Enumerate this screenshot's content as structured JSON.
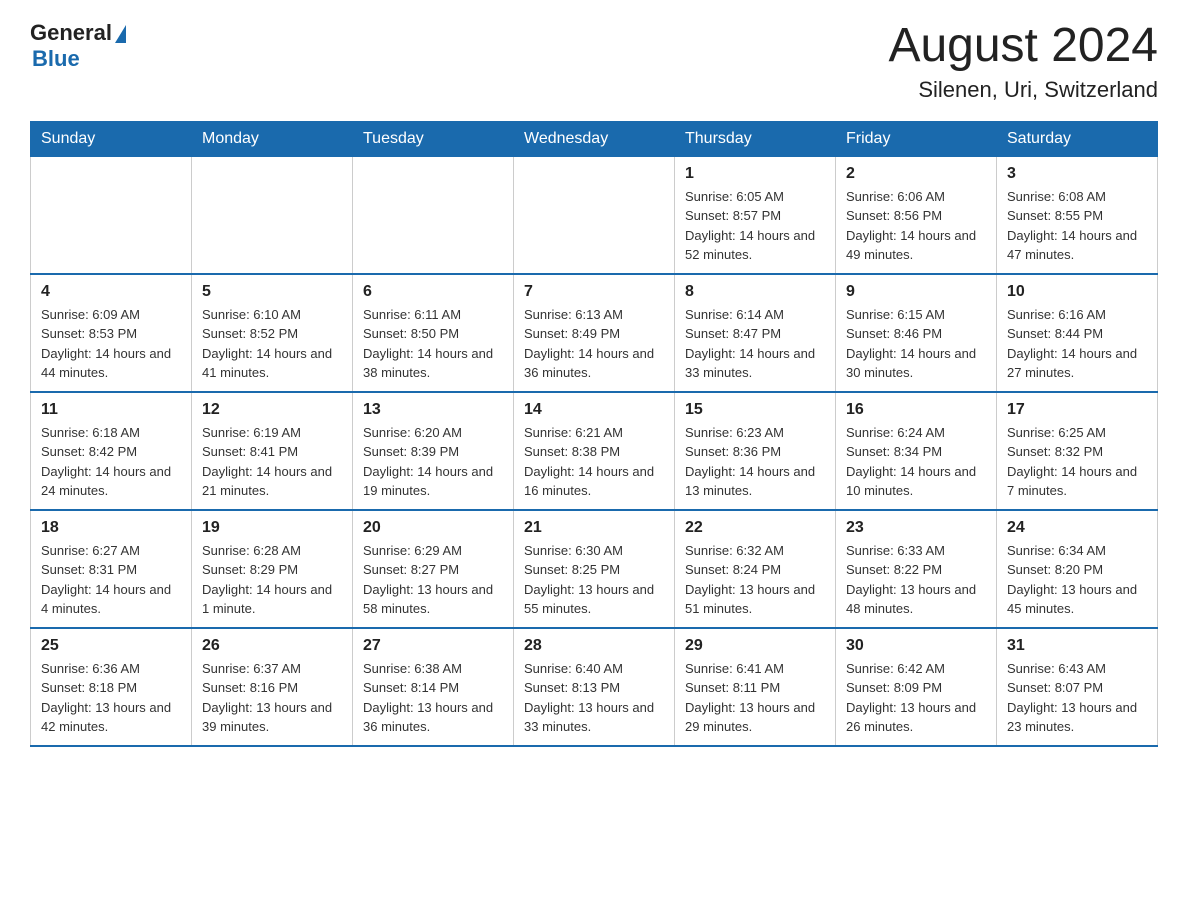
{
  "header": {
    "logo_general": "General",
    "logo_blue": "Blue",
    "month_title": "August 2024",
    "location": "Silenen, Uri, Switzerland"
  },
  "days_of_week": [
    "Sunday",
    "Monday",
    "Tuesday",
    "Wednesday",
    "Thursday",
    "Friday",
    "Saturday"
  ],
  "weeks": [
    [
      {
        "day": "",
        "info": ""
      },
      {
        "day": "",
        "info": ""
      },
      {
        "day": "",
        "info": ""
      },
      {
        "day": "",
        "info": ""
      },
      {
        "day": "1",
        "info": "Sunrise: 6:05 AM\nSunset: 8:57 PM\nDaylight: 14 hours and 52 minutes."
      },
      {
        "day": "2",
        "info": "Sunrise: 6:06 AM\nSunset: 8:56 PM\nDaylight: 14 hours and 49 minutes."
      },
      {
        "day": "3",
        "info": "Sunrise: 6:08 AM\nSunset: 8:55 PM\nDaylight: 14 hours and 47 minutes."
      }
    ],
    [
      {
        "day": "4",
        "info": "Sunrise: 6:09 AM\nSunset: 8:53 PM\nDaylight: 14 hours and 44 minutes."
      },
      {
        "day": "5",
        "info": "Sunrise: 6:10 AM\nSunset: 8:52 PM\nDaylight: 14 hours and 41 minutes."
      },
      {
        "day": "6",
        "info": "Sunrise: 6:11 AM\nSunset: 8:50 PM\nDaylight: 14 hours and 38 minutes."
      },
      {
        "day": "7",
        "info": "Sunrise: 6:13 AM\nSunset: 8:49 PM\nDaylight: 14 hours and 36 minutes."
      },
      {
        "day": "8",
        "info": "Sunrise: 6:14 AM\nSunset: 8:47 PM\nDaylight: 14 hours and 33 minutes."
      },
      {
        "day": "9",
        "info": "Sunrise: 6:15 AM\nSunset: 8:46 PM\nDaylight: 14 hours and 30 minutes."
      },
      {
        "day": "10",
        "info": "Sunrise: 6:16 AM\nSunset: 8:44 PM\nDaylight: 14 hours and 27 minutes."
      }
    ],
    [
      {
        "day": "11",
        "info": "Sunrise: 6:18 AM\nSunset: 8:42 PM\nDaylight: 14 hours and 24 minutes."
      },
      {
        "day": "12",
        "info": "Sunrise: 6:19 AM\nSunset: 8:41 PM\nDaylight: 14 hours and 21 minutes."
      },
      {
        "day": "13",
        "info": "Sunrise: 6:20 AM\nSunset: 8:39 PM\nDaylight: 14 hours and 19 minutes."
      },
      {
        "day": "14",
        "info": "Sunrise: 6:21 AM\nSunset: 8:38 PM\nDaylight: 14 hours and 16 minutes."
      },
      {
        "day": "15",
        "info": "Sunrise: 6:23 AM\nSunset: 8:36 PM\nDaylight: 14 hours and 13 minutes."
      },
      {
        "day": "16",
        "info": "Sunrise: 6:24 AM\nSunset: 8:34 PM\nDaylight: 14 hours and 10 minutes."
      },
      {
        "day": "17",
        "info": "Sunrise: 6:25 AM\nSunset: 8:32 PM\nDaylight: 14 hours and 7 minutes."
      }
    ],
    [
      {
        "day": "18",
        "info": "Sunrise: 6:27 AM\nSunset: 8:31 PM\nDaylight: 14 hours and 4 minutes."
      },
      {
        "day": "19",
        "info": "Sunrise: 6:28 AM\nSunset: 8:29 PM\nDaylight: 14 hours and 1 minute."
      },
      {
        "day": "20",
        "info": "Sunrise: 6:29 AM\nSunset: 8:27 PM\nDaylight: 13 hours and 58 minutes."
      },
      {
        "day": "21",
        "info": "Sunrise: 6:30 AM\nSunset: 8:25 PM\nDaylight: 13 hours and 55 minutes."
      },
      {
        "day": "22",
        "info": "Sunrise: 6:32 AM\nSunset: 8:24 PM\nDaylight: 13 hours and 51 minutes."
      },
      {
        "day": "23",
        "info": "Sunrise: 6:33 AM\nSunset: 8:22 PM\nDaylight: 13 hours and 48 minutes."
      },
      {
        "day": "24",
        "info": "Sunrise: 6:34 AM\nSunset: 8:20 PM\nDaylight: 13 hours and 45 minutes."
      }
    ],
    [
      {
        "day": "25",
        "info": "Sunrise: 6:36 AM\nSunset: 8:18 PM\nDaylight: 13 hours and 42 minutes."
      },
      {
        "day": "26",
        "info": "Sunrise: 6:37 AM\nSunset: 8:16 PM\nDaylight: 13 hours and 39 minutes."
      },
      {
        "day": "27",
        "info": "Sunrise: 6:38 AM\nSunset: 8:14 PM\nDaylight: 13 hours and 36 minutes."
      },
      {
        "day": "28",
        "info": "Sunrise: 6:40 AM\nSunset: 8:13 PM\nDaylight: 13 hours and 33 minutes."
      },
      {
        "day": "29",
        "info": "Sunrise: 6:41 AM\nSunset: 8:11 PM\nDaylight: 13 hours and 29 minutes."
      },
      {
        "day": "30",
        "info": "Sunrise: 6:42 AM\nSunset: 8:09 PM\nDaylight: 13 hours and 26 minutes."
      },
      {
        "day": "31",
        "info": "Sunrise: 6:43 AM\nSunset: 8:07 PM\nDaylight: 13 hours and 23 minutes."
      }
    ]
  ]
}
